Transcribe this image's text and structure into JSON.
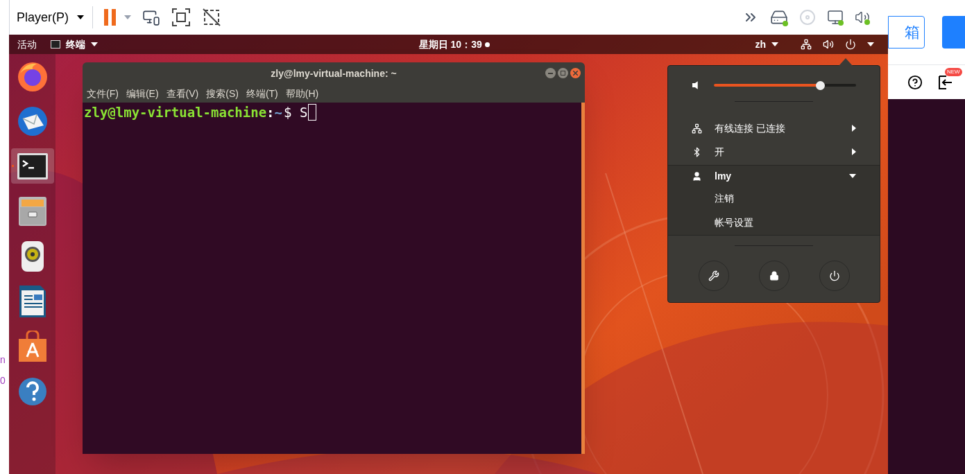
{
  "vm_toolbar": {
    "player_menu": "Player(P)"
  },
  "host_left_edge": [
    "n",
    "0"
  ],
  "top_bar": {
    "activities": "活动",
    "app_menu": "终端",
    "clock": "星期日 10：39",
    "notification": true,
    "input_method": "zh"
  },
  "dock": [
    {
      "kind": "firefox",
      "selected": false
    },
    {
      "kind": "mail",
      "selected": false
    },
    {
      "kind": "terminal",
      "selected": true
    },
    {
      "kind": "files",
      "selected": false
    },
    {
      "kind": "music",
      "selected": false
    },
    {
      "kind": "writer",
      "selected": false
    },
    {
      "kind": "store",
      "selected": false
    },
    {
      "kind": "help",
      "selected": false
    }
  ],
  "terminal": {
    "title": "zly@lmy-virtual-machine: ~",
    "menu": [
      "文件(F)",
      "编辑(E)",
      "查看(V)",
      "搜索(S)",
      "终端(T)",
      "帮助(H)"
    ],
    "user_host": "zly@lmy-virtual-machine",
    "separator": ":",
    "path": "~",
    "command": "$ S"
  },
  "system_menu": {
    "volume": {
      "level": 0.75
    },
    "items": [
      {
        "kind": "network",
        "label": "有线连接 已连接"
      },
      {
        "kind": "bluetooth",
        "label": "开"
      }
    ],
    "user": {
      "name": "lmy",
      "expanded": true,
      "items": [
        "注销",
        "帐号设置"
      ]
    }
  },
  "browser_side": {
    "draft_button": "箱",
    "badge": "NEW"
  }
}
